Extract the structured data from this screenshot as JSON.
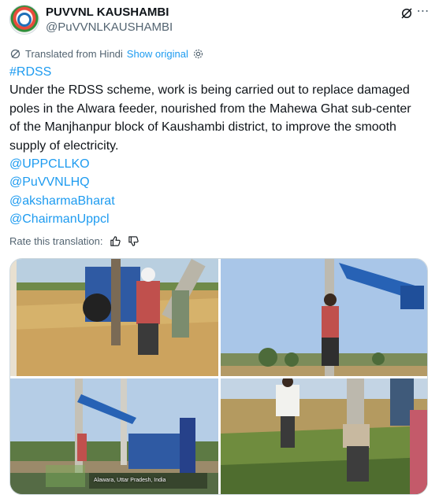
{
  "account": {
    "display_name": "PUVVNL KAUSHAMBI",
    "handle": "@PuVVNLKAUSHAMBI"
  },
  "translation": {
    "label": "Translated from Hindi",
    "show_original": "Show original"
  },
  "tweet": {
    "hashtag": "#RDSS",
    "body": "Under the RDSS scheme, work is being carried out to replace damaged poles in the Alwara feeder, nourished from the Mahewa Ghat sub-center of the Manjhanpur block of Kaushambi district, to improve the smooth supply of electricity.",
    "mentions": [
      "@UPPCLLKO",
      "@PuVVNLHQ",
      "@aksharmaBharat",
      "@ChairmanUppcl"
    ]
  },
  "rate": {
    "label": "Rate this translation:"
  },
  "media": {
    "geo_tag": "Alawara, Uttar Pradesh, India"
  },
  "icons": {
    "grok": "grok-icon",
    "more": "more-options-icon",
    "translate": "translate-icon",
    "settings": "gear-icon",
    "thumbs_up": "thumbs-up-icon",
    "thumbs_down": "thumbs-down-icon"
  },
  "colors": {
    "link": "#1d9bf0",
    "secondary_text": "#536471",
    "text": "#0f1419"
  }
}
